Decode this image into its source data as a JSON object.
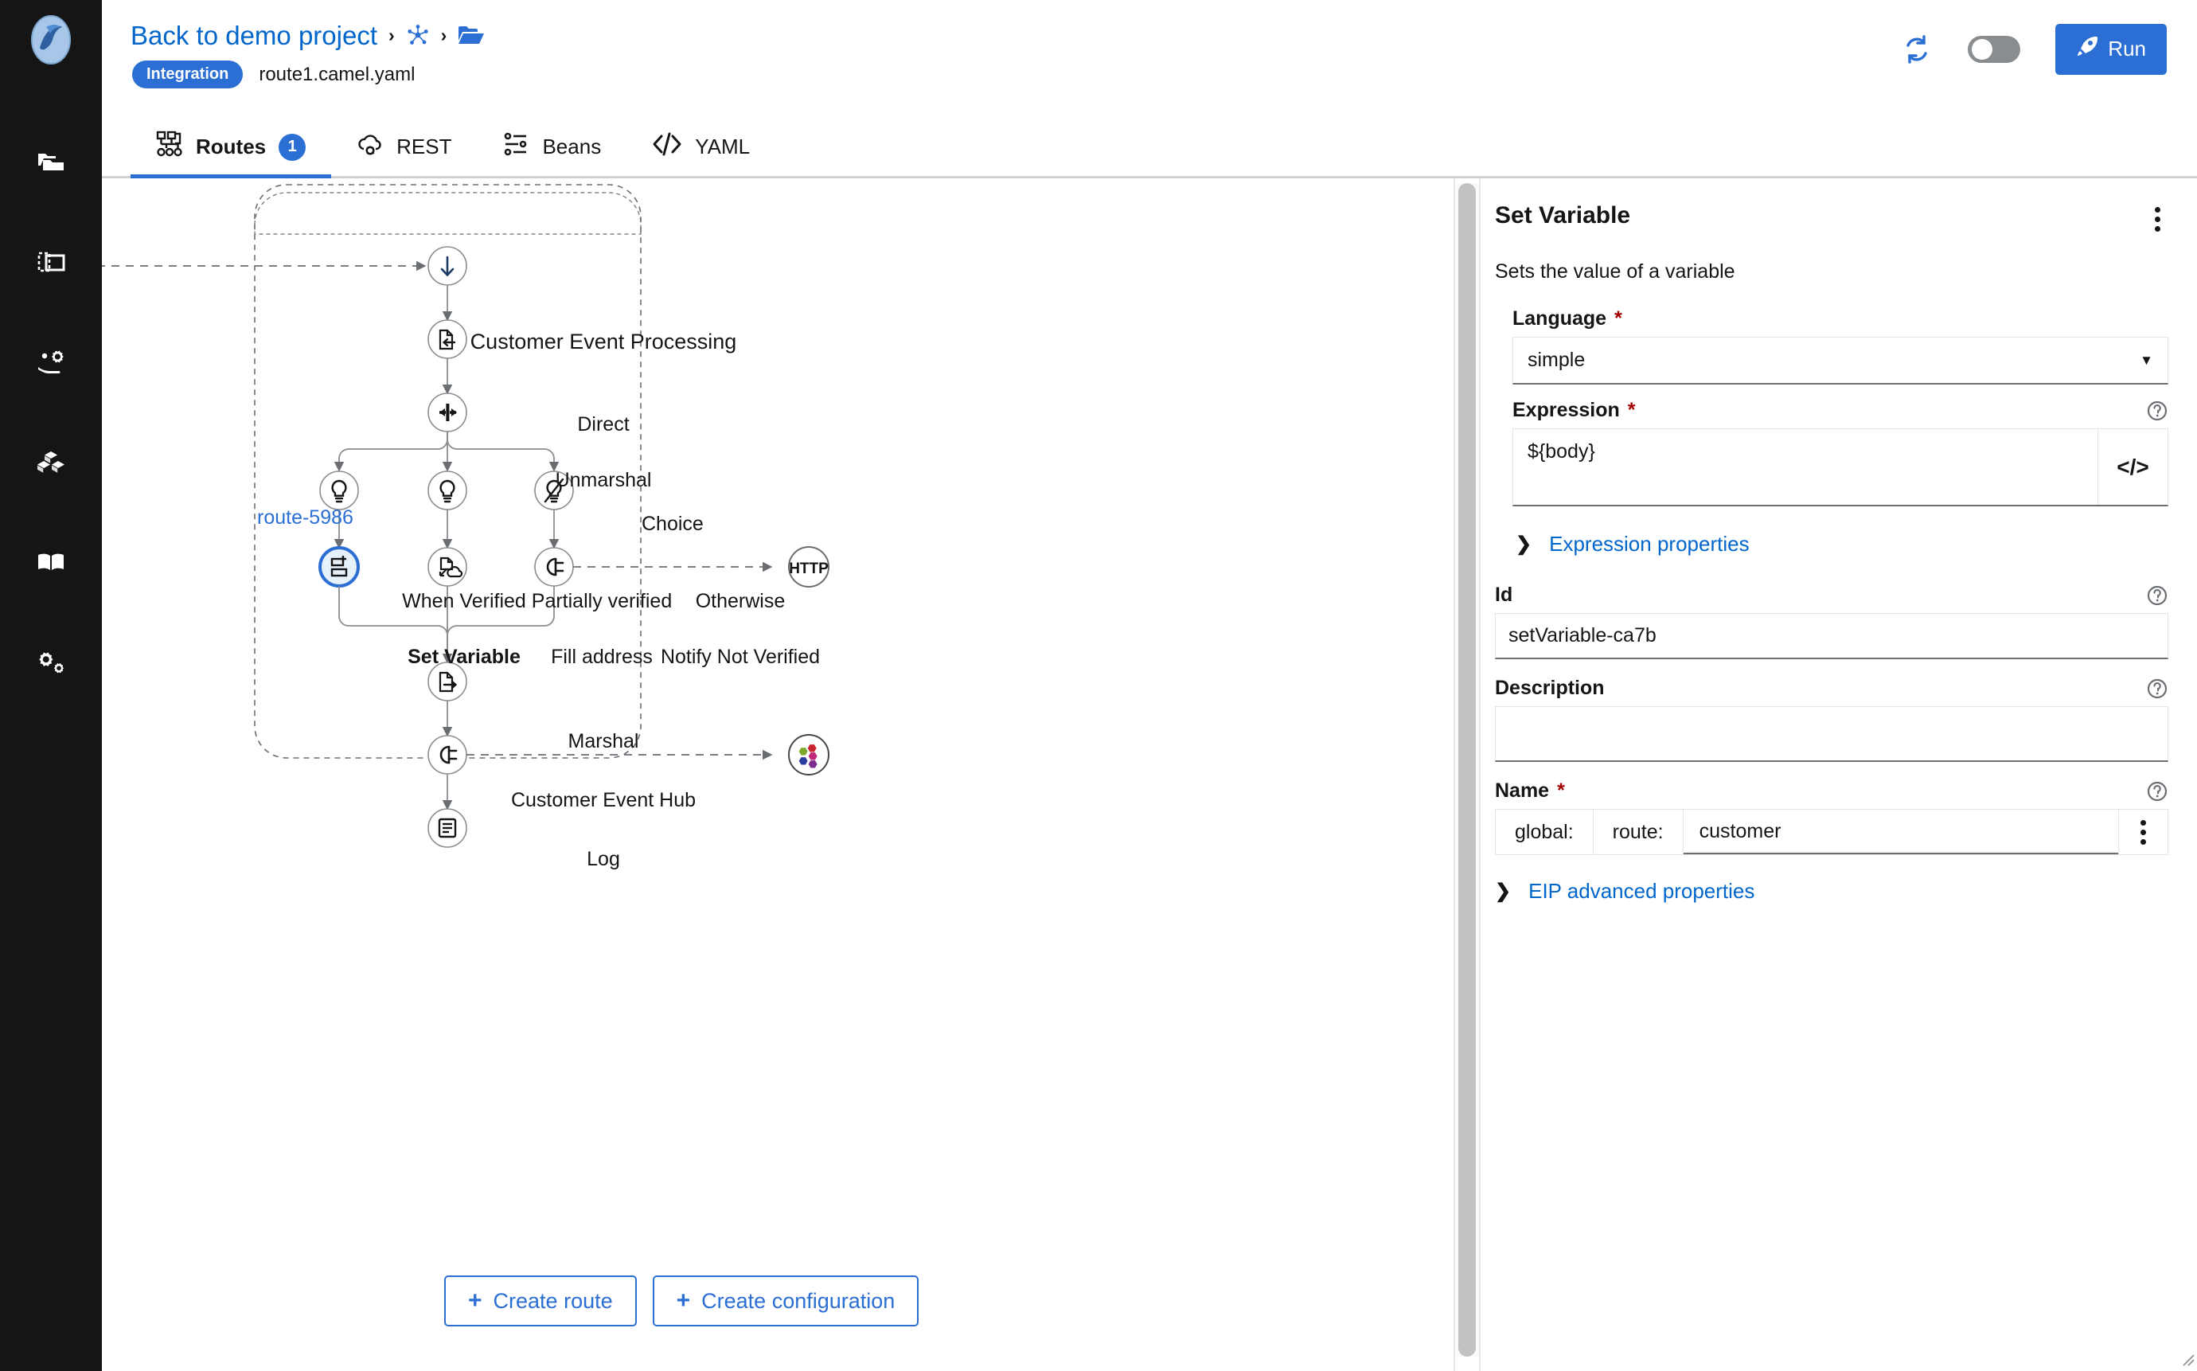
{
  "rail": {
    "logo_name": "camel-logo",
    "items": [
      {
        "name": "projects-icon"
      },
      {
        "name": "containers-icon"
      },
      {
        "name": "services-icon"
      },
      {
        "name": "blocks-icon"
      },
      {
        "name": "book-icon"
      },
      {
        "name": "gears-icon"
      }
    ]
  },
  "header": {
    "breadcrumb_link": "Back to demo project",
    "breadcrumb_sep": "›",
    "topology_icon": "topology-icon",
    "folder_icon": "folder-icon",
    "badge": "Integration",
    "file_name": "route1.camel.yaml",
    "refresh_icon": "refresh-icon",
    "toggle_name": "dev-mode-toggle",
    "run_label": "Run",
    "run_icon": "rocket-icon",
    "accent": "#2b6fd4"
  },
  "tabs": [
    {
      "label": "Routes",
      "icon": "routes-icon",
      "badge": "1",
      "active": true
    },
    {
      "label": "REST",
      "icon": "rest-cloud-icon",
      "badge": "",
      "active": false
    },
    {
      "label": "Beans",
      "icon": "beans-icon",
      "badge": "",
      "active": false
    },
    {
      "label": "YAML",
      "icon": "code-icon",
      "badge": "",
      "active": false
    }
  ],
  "canvas": {
    "route_label": "route-5986",
    "group_title": "Customer Event Processing",
    "nodes": [
      {
        "id": "direct",
        "label": "Direct",
        "icon": "arrow-down-icon",
        "bold": false
      },
      {
        "id": "unmarshal",
        "label": "Unmarshal",
        "icon": "unmarshal-icon",
        "bold": false
      },
      {
        "id": "choice",
        "label": "Choice",
        "icon": "choice-icon",
        "bold": false
      },
      {
        "id": "when-verified",
        "label": "When Verified",
        "icon": "bulb-icon",
        "bold": false
      },
      {
        "id": "partially-verified",
        "label": "Partially verified",
        "icon": "bulb-icon",
        "bold": false
      },
      {
        "id": "otherwise",
        "label": "Otherwise",
        "icon": "bulb-off-icon",
        "bold": false
      },
      {
        "id": "set-variable",
        "label": "Set Variable",
        "icon": "set-variable-icon",
        "bold": true
      },
      {
        "id": "fill-address",
        "label": "Fill address",
        "icon": "to-cloud-icon",
        "bold": false
      },
      {
        "id": "notify-not-verified",
        "label": "Notify Not Verified",
        "icon": "plug-icon",
        "bold": false
      },
      {
        "id": "marshal",
        "label": "Marshal",
        "icon": "marshal-icon",
        "bold": false
      },
      {
        "id": "customer-event-hub",
        "label": "Customer Event Hub",
        "icon": "plug-icon",
        "bold": false
      },
      {
        "id": "log",
        "label": "Log",
        "icon": "log-icon",
        "bold": false
      }
    ],
    "endpoints": [
      {
        "id": "http-endpoint",
        "label": "HTTP"
      },
      {
        "id": "kafka-endpoint",
        "label": ""
      }
    ],
    "create_route_label": "Create route",
    "create_configuration_label": "Create configuration",
    "plus_glyph": "+"
  },
  "panel": {
    "title": "Set Variable",
    "kebab_name": "panel-kebab-menu",
    "description": "Sets the value of a variable",
    "language": {
      "label": "Language",
      "required": "*",
      "value": "simple",
      "caret": "▼"
    },
    "expression": {
      "label": "Expression",
      "required": "*",
      "value": "${body}",
      "code_glyph": "</>"
    },
    "expression_properties_label": "Expression properties",
    "id": {
      "label": "Id",
      "value": "setVariable-ca7b"
    },
    "description_field": {
      "label": "Description",
      "value": ""
    },
    "name": {
      "label": "Name",
      "required": "*",
      "scope_global": "global:",
      "scope_route": "route:",
      "value": "customer"
    },
    "eip_advanced_label": "EIP advanced properties",
    "caret_right": "❯"
  }
}
